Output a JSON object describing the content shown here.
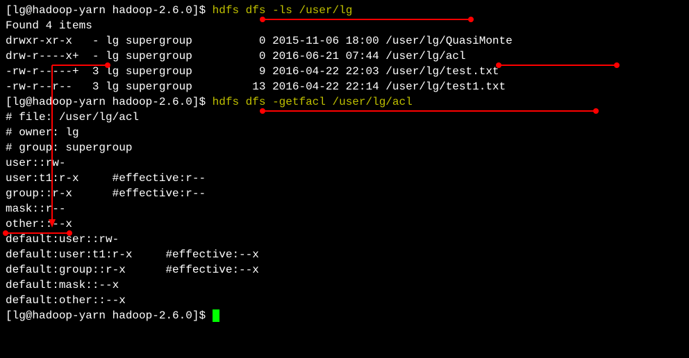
{
  "prompt": "[lg@hadoop-yarn hadoop-2.6.0]$ ",
  "cmd1": "hdfs dfs -ls /user/lg",
  "ls_header": "Found 4 items",
  "ls_rows": [
    "drwxr-xr-x   - lg supergroup          0 2015-11-06 18:00 /user/lg/QuasiMonte",
    "drw-r----x+  - lg supergroup          0 2016-06-21 07:44 /user/lg/acl",
    "-rw-r-----+  3 lg supergroup          9 2016-04-22 22:03 /user/lg/test.txt",
    "-rw-r--r--   3 lg supergroup         13 2016-04-22 22:14 /user/lg/test1.txt"
  ],
  "cmd2": "hdfs dfs -getfacl /user/lg/acl",
  "acl_lines": [
    "# file: /user/lg/acl",
    "# owner: lg",
    "# group: supergroup",
    "user::rw-",
    "user:t1:r-x     #effective:r--",
    "group::r-x      #effective:r--",
    "mask::r--",
    "other::--x",
    "default:user::rw-",
    "default:user:t1:r-x     #effective:--x",
    "default:group::r-x      #effective:--x",
    "default:mask::--x",
    "default:other::--x"
  ],
  "blank": ""
}
